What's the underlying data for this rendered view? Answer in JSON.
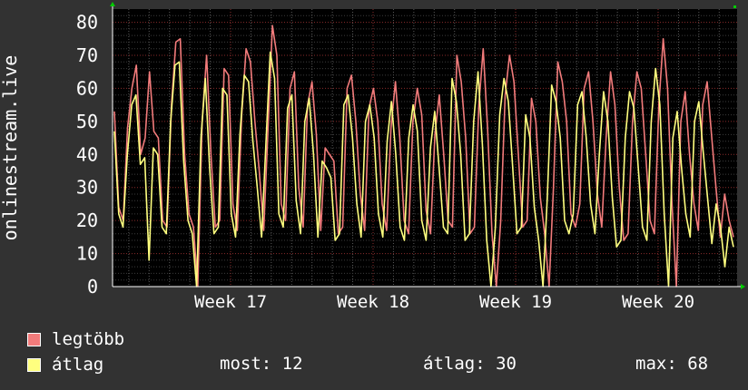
{
  "chart_data": {
    "type": "line",
    "ylabel": "onlinestream.live",
    "ylim": [
      0,
      84
    ],
    "yticks": [
      0,
      10,
      20,
      30,
      40,
      50,
      60,
      70,
      80
    ],
    "xticks": [
      "Week 17",
      "Week 18",
      "Week 19",
      "Week 20"
    ],
    "grid": true,
    "series": [
      {
        "name": "legtöbb",
        "color": "#f27b7b",
        "values": [
          53,
          24,
          20,
          48,
          60,
          67,
          40,
          45,
          65,
          47,
          45,
          20,
          18,
          55,
          74,
          75,
          40,
          22,
          18,
          0,
          50,
          70,
          40,
          18,
          20,
          66,
          64,
          25,
          17,
          52,
          72,
          68,
          50,
          35,
          17,
          48,
          79,
          70,
          25,
          20,
          60,
          65,
          30,
          18,
          55,
          62,
          46,
          17,
          42,
          40,
          38,
          16,
          18,
          60,
          64,
          50,
          28,
          17,
          54,
          60,
          50,
          25,
          17,
          48,
          62,
          45,
          20,
          16,
          50,
          60,
          52,
          23,
          16,
          46,
          58,
          40,
          20,
          18,
          70,
          62,
          45,
          16,
          18,
          55,
          72,
          48,
          16,
          0,
          20,
          58,
          70,
          62,
          40,
          18,
          20,
          57,
          50,
          27,
          16,
          0,
          30,
          68,
          62,
          50,
          22,
          18,
          25,
          60,
          65,
          50,
          28,
          18,
          45,
          65,
          55,
          30,
          14,
          16,
          50,
          65,
          60,
          40,
          20,
          16,
          55,
          75,
          60,
          25,
          0,
          50,
          59,
          40,
          25,
          17,
          55,
          62,
          46,
          30,
          15,
          28,
          20,
          15
        ]
      },
      {
        "name": "átlag",
        "color": "#ffff7f",
        "values": [
          47,
          22,
          18,
          40,
          55,
          58,
          37,
          39,
          8,
          42,
          40,
          18,
          16,
          50,
          67,
          68,
          38,
          20,
          16,
          0,
          45,
          63,
          36,
          16,
          18,
          60,
          58,
          22,
          15,
          46,
          64,
          62,
          44,
          30,
          15,
          43,
          71,
          63,
          22,
          18,
          54,
          58,
          26,
          16,
          50,
          57,
          40,
          15,
          38,
          36,
          33,
          14,
          16,
          55,
          58,
          45,
          25,
          15,
          50,
          55,
          45,
          22,
          15,
          44,
          56,
          40,
          18,
          14,
          45,
          55,
          47,
          20,
          14,
          42,
          53,
          36,
          18,
          16,
          63,
          56,
          40,
          14,
          16,
          50,
          65,
          43,
          14,
          0,
          18,
          52,
          63,
          56,
          36,
          16,
          18,
          52,
          45,
          24,
          14,
          0,
          27,
          61,
          56,
          45,
          20,
          16,
          22,
          55,
          59,
          45,
          25,
          16,
          40,
          59,
          50,
          27,
          12,
          14,
          45,
          59,
          54,
          36,
          18,
          14,
          50,
          66,
          55,
          22,
          0,
          45,
          53,
          36,
          22,
          15,
          50,
          56,
          41,
          27,
          13,
          25,
          18,
          6,
          18,
          12
        ]
      }
    ]
  },
  "legend": [
    {
      "label": "legtöbb",
      "color": "#f27b7b"
    },
    {
      "label": "átlag",
      "color": "#ffff7f"
    }
  ],
  "stats": {
    "most": "most: 12",
    "atlag": "átlag: 30",
    "max": "max: 68"
  }
}
